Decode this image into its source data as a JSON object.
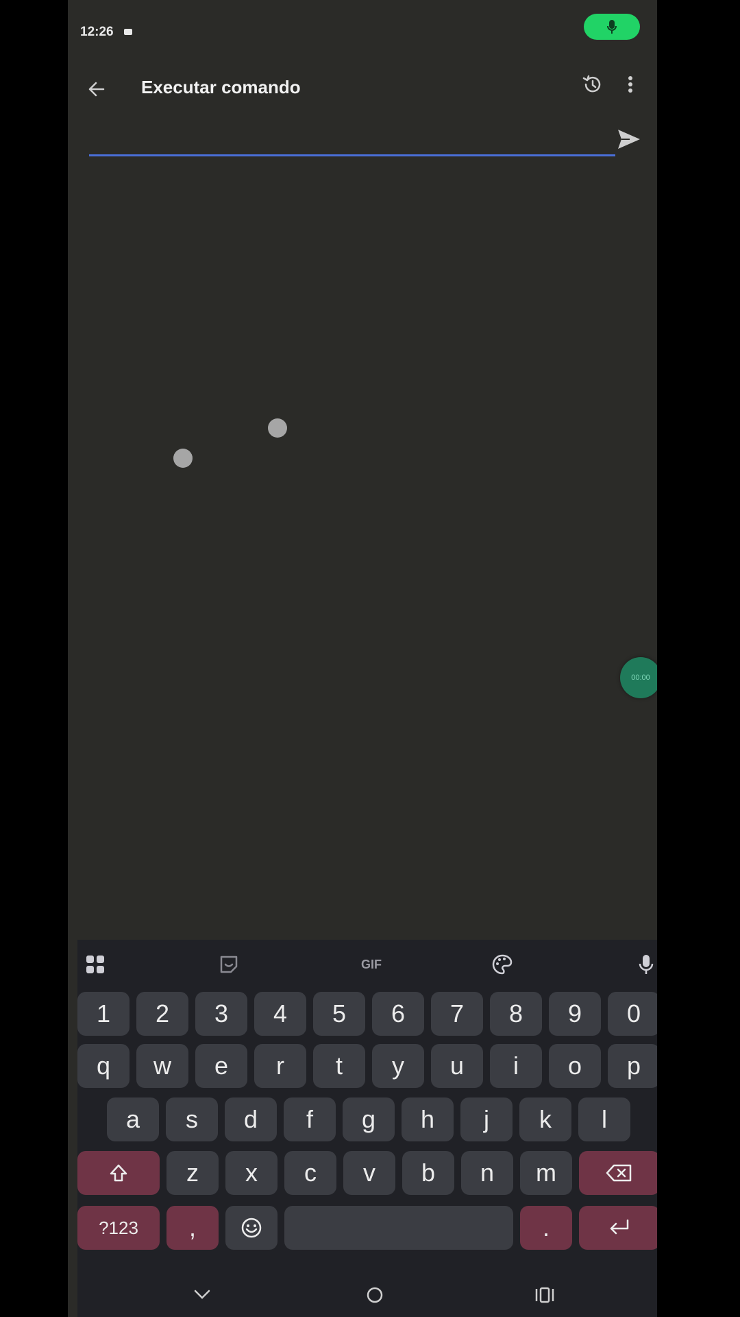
{
  "status_bar": {
    "time": "12:26"
  },
  "app_bar": {
    "title": "Executar comando"
  },
  "command": {
    "value": "",
    "placeholder": ""
  },
  "recorder": {
    "label": "00:00"
  },
  "keyboard": {
    "toolbar": {
      "gif_label": "GIF"
    },
    "number_row": [
      "1",
      "2",
      "3",
      "4",
      "5",
      "6",
      "7",
      "8",
      "9",
      "0"
    ],
    "row1": [
      "q",
      "w",
      "e",
      "r",
      "t",
      "y",
      "u",
      "i",
      "o",
      "p"
    ],
    "row2": [
      "a",
      "s",
      "d",
      "f",
      "g",
      "h",
      "j",
      "k",
      "l"
    ],
    "row3": [
      "z",
      "x",
      "c",
      "v",
      "b",
      "n",
      "m"
    ],
    "symbols_label": "?123",
    "comma_label": ",",
    "period_label": "."
  },
  "colors": {
    "accent_input": "#4a6fd8",
    "mic_pill": "#21d366",
    "keyboard_accent": "#6f3446"
  }
}
